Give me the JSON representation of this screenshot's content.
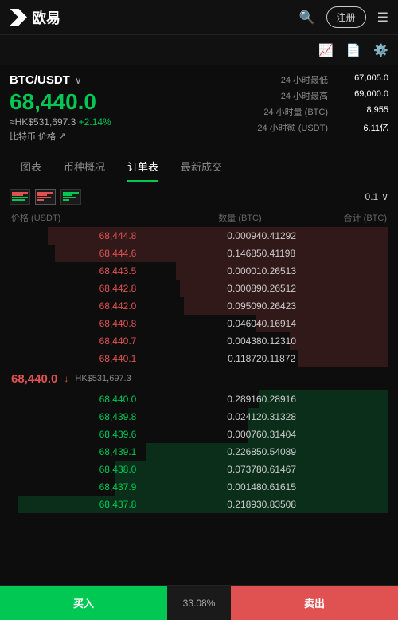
{
  "header": {
    "logo_text": "欧易",
    "register_label": "注册"
  },
  "price_section": {
    "pair": "BTC/USDT",
    "main_price": "68,440.0",
    "hk_price": "≈HK$531,697.3",
    "change": "+2.14%",
    "btc_label": "比特币 价格",
    "stats": [
      {
        "label": "24 小时最低",
        "value": "67,005.0"
      },
      {
        "label": "24 小时最高",
        "value": "69,000.0"
      },
      {
        "label": "24 小时量 (BTC)",
        "value": "8,955"
      },
      {
        "label": "24 小时额 (USDT)",
        "value": "6.11亿"
      }
    ]
  },
  "tabs": [
    {
      "id": "chart",
      "label": "图表"
    },
    {
      "id": "overview",
      "label": "币种概况"
    },
    {
      "id": "orderbook",
      "label": "订单表"
    },
    {
      "id": "trades",
      "label": "最新成交"
    }
  ],
  "orderbook": {
    "precision": "0.1",
    "col_price": "价格 (USDT)",
    "col_qty": "数量 (BTC)",
    "col_total": "合计 (BTC)",
    "asks": [
      {
        "price": "68,444.8",
        "qty": "0.00094",
        "total": "0.41292",
        "bar_pct": 90
      },
      {
        "price": "68,444.6",
        "qty": "0.14685",
        "total": "0.41198",
        "bar_pct": 88
      },
      {
        "price": "68,443.5",
        "qty": "0.00001",
        "total": "0.26513",
        "bar_pct": 56
      },
      {
        "price": "68,442.8",
        "qty": "0.00089",
        "total": "0.26512",
        "bar_pct": 55
      },
      {
        "price": "68,442.0",
        "qty": "0.09509",
        "total": "0.26423",
        "bar_pct": 54
      },
      {
        "price": "68,440.8",
        "qty": "0.04604",
        "total": "0.16914",
        "bar_pct": 35
      },
      {
        "price": "68,440.7",
        "qty": "0.00438",
        "total": "0.12310",
        "bar_pct": 26
      },
      {
        "price": "68,440.1",
        "qty": "0.11872",
        "total": "0.11872",
        "bar_pct": 24
      }
    ],
    "mid_price": "68,440.0",
    "mid_price_hk": "HK$531,697.3",
    "bids": [
      {
        "price": "68,440.0",
        "qty": "0.28916",
        "total": "0.28916",
        "bar_pct": 34
      },
      {
        "price": "68,439.8",
        "qty": "0.02412",
        "total": "0.31328",
        "bar_pct": 37
      },
      {
        "price": "68,439.6",
        "qty": "0.00076",
        "total": "0.31404",
        "bar_pct": 37
      },
      {
        "price": "68,439.1",
        "qty": "0.22685",
        "total": "0.54089",
        "bar_pct": 64
      },
      {
        "price": "68,438.0",
        "qty": "0.07378",
        "total": "0.61467",
        "bar_pct": 72
      },
      {
        "price": "68,437.9",
        "qty": "0.00148",
        "total": "0.61615",
        "bar_pct": 72
      },
      {
        "price": "68,437.8",
        "qty": "0.21893",
        "total": "0.83508",
        "bar_pct": 98
      }
    ]
  },
  "bottom": {
    "buy_label": "买入",
    "sell_label": "卖出",
    "pct_buy": "33.08%",
    "pct_sell": "33.08%"
  }
}
